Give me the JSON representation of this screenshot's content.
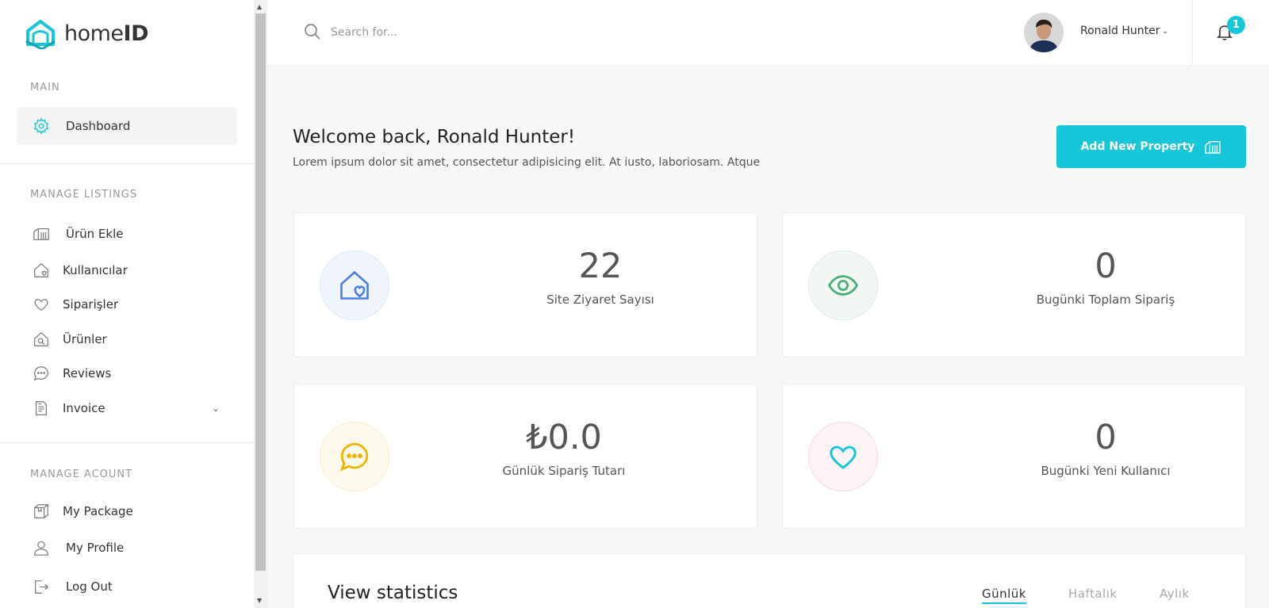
{
  "brand": {
    "name_light": "home",
    "name_bold": "ID",
    "accent": "#17c6d8"
  },
  "sidebar": {
    "sections": [
      {
        "label": "MAIN"
      },
      {
        "label": "MANAGE LISTINGS"
      },
      {
        "label": "MANAGE ACOUNT"
      }
    ],
    "main_items": [
      {
        "label": "Dashboard",
        "icon": "gear-icon",
        "active": true
      }
    ],
    "listing_items": [
      {
        "label": "Ürün Ekle",
        "icon": "building-icon"
      },
      {
        "label": "Kullanıcılar",
        "icon": "house-heart-icon"
      },
      {
        "label": "Siparişler",
        "icon": "heart-icon"
      },
      {
        "label": "Ürünler",
        "icon": "house-search-icon"
      },
      {
        "label": "Reviews",
        "icon": "chat-icon"
      },
      {
        "label": "Invoice",
        "icon": "document-icon"
      }
    ],
    "account_items": [
      {
        "label": "My Package",
        "icon": "package-icon"
      },
      {
        "label": "My Profile",
        "icon": "user-icon"
      },
      {
        "label": "Log Out",
        "icon": "logout-icon"
      }
    ]
  },
  "header": {
    "search_placeholder": "Search for...",
    "user_name": "Ronald Hunter",
    "notification_count": "1"
  },
  "main": {
    "welcome_title": "Welcome back, Ronald Hunter!",
    "welcome_subtitle": "Lorem ipsum dolor sit amet, consectetur adipisicing elit. At iusto, laboriosam. Atque",
    "add_button_label": "Add New Property",
    "cards": [
      {
        "value": "22",
        "caption": "Site Ziyaret Sayısı",
        "icon": "house-heart-icon",
        "color": "#4a7fe0"
      },
      {
        "value": "0",
        "caption": "Bugünki Toplam Sipariş",
        "icon": "eye-icon",
        "color": "#4caf78"
      },
      {
        "value": "₺0.0",
        "caption": "Günlük Sipariş Tutarı",
        "icon": "chat-icon",
        "color": "#f0b400"
      },
      {
        "value": "0",
        "caption": "Bugünki Yeni Kullanıcı",
        "icon": "heart-icon",
        "color": "#17c6d8"
      }
    ],
    "stats": {
      "title": "View statistics",
      "tabs": [
        "Günlük",
        "Haftalık",
        "Aylık"
      ],
      "active_tab": "Günlük"
    }
  }
}
